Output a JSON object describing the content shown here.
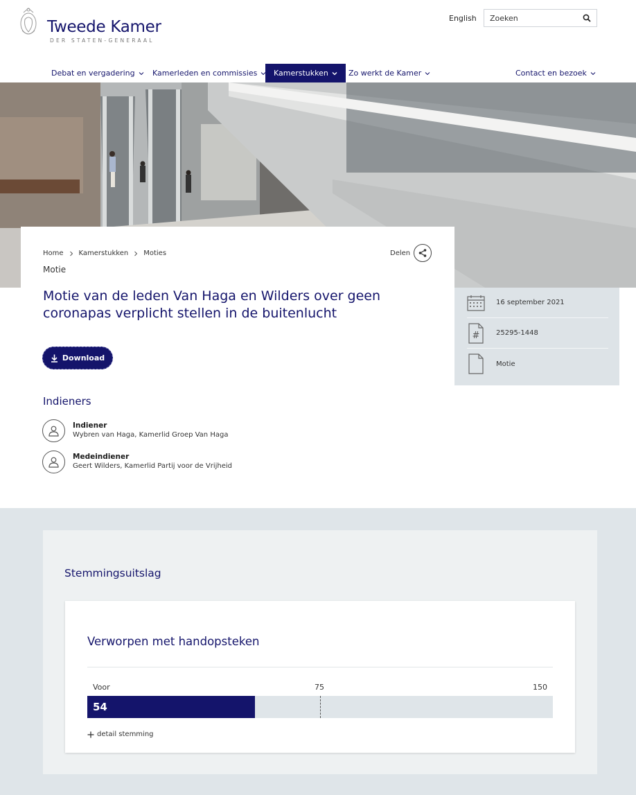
{
  "header": {
    "logo_title": "Tweede Kamer",
    "logo_subtitle": "DER STATEN-GENERAAL",
    "language_link": "English",
    "search_placeholder": "Zoeken"
  },
  "nav": {
    "items": [
      {
        "label": "Debat en vergadering",
        "active": false
      },
      {
        "label": "Kamerleden en commissies",
        "active": false
      },
      {
        "label": "Kamerstukken",
        "active": true
      },
      {
        "label": "Zo werkt de Kamer",
        "active": false
      },
      {
        "label": "Contact en bezoek",
        "active": false
      }
    ]
  },
  "breadcrumb": [
    "Home",
    "Kamerstukken",
    "Moties"
  ],
  "share_label": "Delen",
  "doc_type": "Motie",
  "title": "Motie van de leden Van Haga en Wilders over geen coronapas verplicht stellen in de buitenlucht",
  "download_label": "Download",
  "indieners": {
    "heading": "Indieners",
    "people": [
      {
        "role": "Indiener",
        "name": "Wybren van Haga, Kamerlid Groep Van Haga"
      },
      {
        "role": "Medeindiener",
        "name": "Geert Wilders, Kamerlid Partij voor de Vrijheid"
      }
    ]
  },
  "meta": {
    "date": "16 september 2021",
    "number": "25295-1448",
    "type": "Motie"
  },
  "voting": {
    "heading": "Stemmingsuitslag",
    "result": "Verworpen met handopsteken",
    "voor_label": "Voor",
    "voor_value": 54,
    "voor_text": "54",
    "mid_value": 75,
    "mid_text": "75",
    "max_value": 150,
    "max_text": "150",
    "detail_label": "detail stemming"
  },
  "colors": {
    "brand": "#14146b",
    "meta_bg": "#dde3e7",
    "section_bg": "#dfe5e9"
  }
}
